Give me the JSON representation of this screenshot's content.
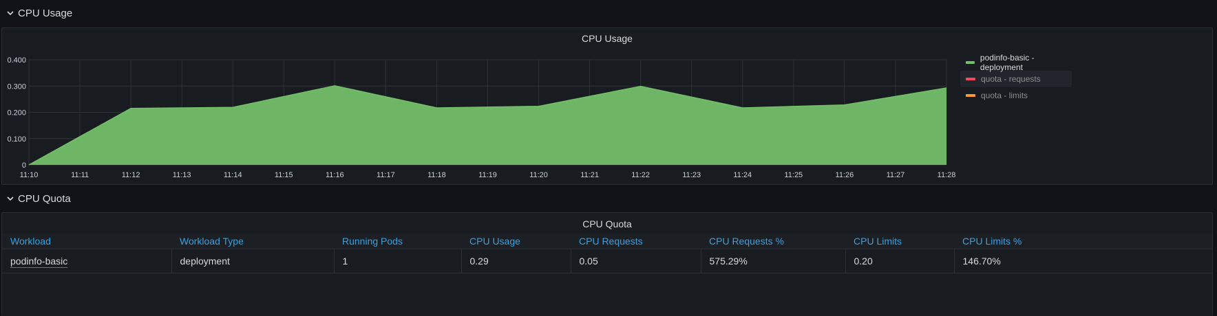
{
  "rows": {
    "usage_title": "CPU Usage",
    "quota_title": "CPU Quota"
  },
  "usage_panel": {
    "title": "CPU Usage",
    "legend": [
      {
        "label": "podinfo-basic - deployment",
        "color": "#73bf69",
        "active": true
      },
      {
        "label": "quota - requests",
        "color": "#f2495c",
        "active": false
      },
      {
        "label": "quota - limits",
        "color": "#ff9830",
        "active": false
      }
    ]
  },
  "chart_data": {
    "type": "area",
    "title": "CPU Usage",
    "xlabel": "",
    "ylabel": "",
    "x": [
      "11:10",
      "11:11",
      "11:12",
      "11:13",
      "11:14",
      "11:15",
      "11:16",
      "11:17",
      "11:18",
      "11:19",
      "11:20",
      "11:21",
      "11:22",
      "11:23",
      "11:24",
      "11:25",
      "11:26",
      "11:27",
      "11:28"
    ],
    "y_ticks": [
      "0",
      "0.100",
      "0.200",
      "0.300",
      "0.400"
    ],
    "ylim": [
      0,
      0.4
    ],
    "grid": true,
    "legend_position": "right",
    "series": [
      {
        "name": "podinfo-basic - deployment",
        "color": "#73bf69",
        "points": [
          {
            "x": "11:10",
            "y": 0.0
          },
          {
            "x": "11:12",
            "y": 0.215
          },
          {
            "x": "11:14",
            "y": 0.219
          },
          {
            "x": "11:16",
            "y": 0.301
          },
          {
            "x": "11:18",
            "y": 0.217
          },
          {
            "x": "11:20",
            "y": 0.223
          },
          {
            "x": "11:22",
            "y": 0.299
          },
          {
            "x": "11:24",
            "y": 0.217
          },
          {
            "x": "11:26",
            "y": 0.228
          },
          {
            "x": "11:28",
            "y": 0.293
          }
        ]
      }
    ]
  },
  "quota_panel": {
    "title": "CPU Quota",
    "columns": [
      "Workload",
      "Workload Type",
      "Running Pods",
      "CPU Usage",
      "CPU Requests",
      "CPU Requests %",
      "CPU Limits",
      "CPU Limits %"
    ],
    "rows": [
      [
        "podinfo-basic",
        "deployment",
        "1",
        "0.29",
        "0.05",
        "575.29%",
        "0.20",
        "146.70%"
      ]
    ]
  }
}
